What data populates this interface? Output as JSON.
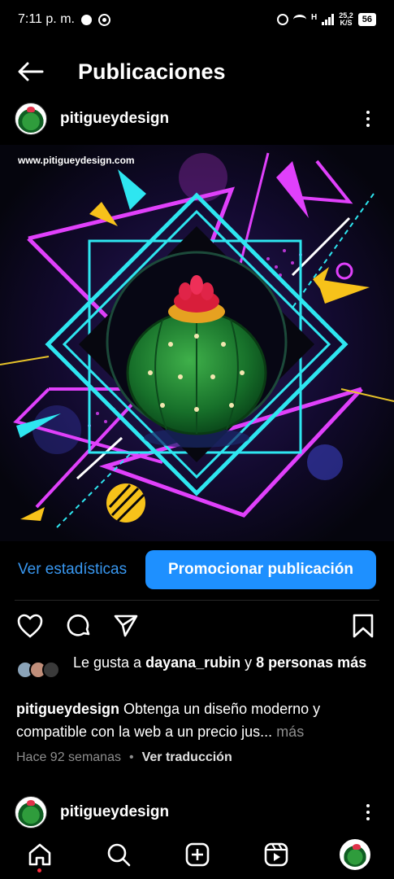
{
  "status_bar": {
    "time": "7:11 p. m.",
    "network_type": "H",
    "net_speed_value": "25,2",
    "net_speed_unit": "K/S",
    "battery": "56"
  },
  "header": {
    "title": "Publicaciones"
  },
  "post": {
    "username": "pitigueydesign",
    "image_watermark": "www.pitigueydesign.com",
    "stats_link": "Ver estadísticas",
    "promote_button": "Promocionar publicación",
    "likes_prefix": "Le gusta a ",
    "likes_user": "dayana_rubin",
    "likes_middle": " y ",
    "likes_count": "8 personas más",
    "caption_user": "pitigueydesign",
    "caption_text": " Obtenga un diseño moderno y compatible con la web a un precio jus...",
    "caption_more": " más",
    "time_ago": "Hace 92 semanas",
    "separator": "•",
    "translate": "Ver traducción"
  },
  "next_post": {
    "username": "pitigueydesign"
  },
  "colors": {
    "accent_blue": "#1e90ff",
    "link_blue": "#3897f0",
    "neon_magenta": "#e040fb",
    "neon_cyan": "#2ee6f0"
  },
  "bottom_nav": {
    "items": [
      "home-icon",
      "search-icon",
      "create-icon",
      "reels-icon",
      "profile-avatar"
    ]
  }
}
